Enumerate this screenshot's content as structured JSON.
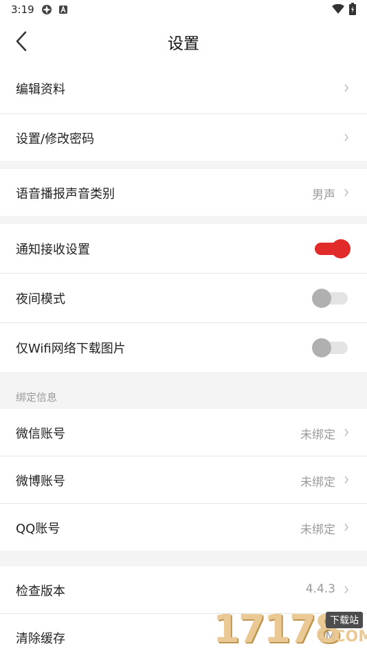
{
  "status_bar": {
    "time": "3:19"
  },
  "nav": {
    "title": "设置"
  },
  "rows": {
    "edit_profile": {
      "label": "编辑资料"
    },
    "password": {
      "label": "设置/修改密码"
    },
    "voice_type": {
      "label": "语音播报声音类别",
      "value": "男声"
    },
    "notify": {
      "label": "通知接收设置",
      "enabled": true
    },
    "night_mode": {
      "label": "夜间模式",
      "enabled": false
    },
    "wifi_images": {
      "label": "仅Wifi网络下载图片",
      "enabled": false
    },
    "wechat": {
      "label": "微信账号",
      "value": "未绑定"
    },
    "weibo": {
      "label": "微博账号",
      "value": "未绑定"
    },
    "qq": {
      "label": "QQ账号",
      "value": "未绑定"
    },
    "version": {
      "label": "检查版本",
      "value": "4.4.3"
    },
    "cache": {
      "label": "清除缓存",
      "value": "0M"
    }
  },
  "sections": {
    "binding_header": "绑定信息"
  },
  "watermark": {
    "digits": "17178",
    "tag": "下载站",
    "suffix": ".COM"
  },
  "colors": {
    "accent": "#e12a2a",
    "background": "#f4f4f4",
    "secondary_text": "#9a9a9a"
  }
}
